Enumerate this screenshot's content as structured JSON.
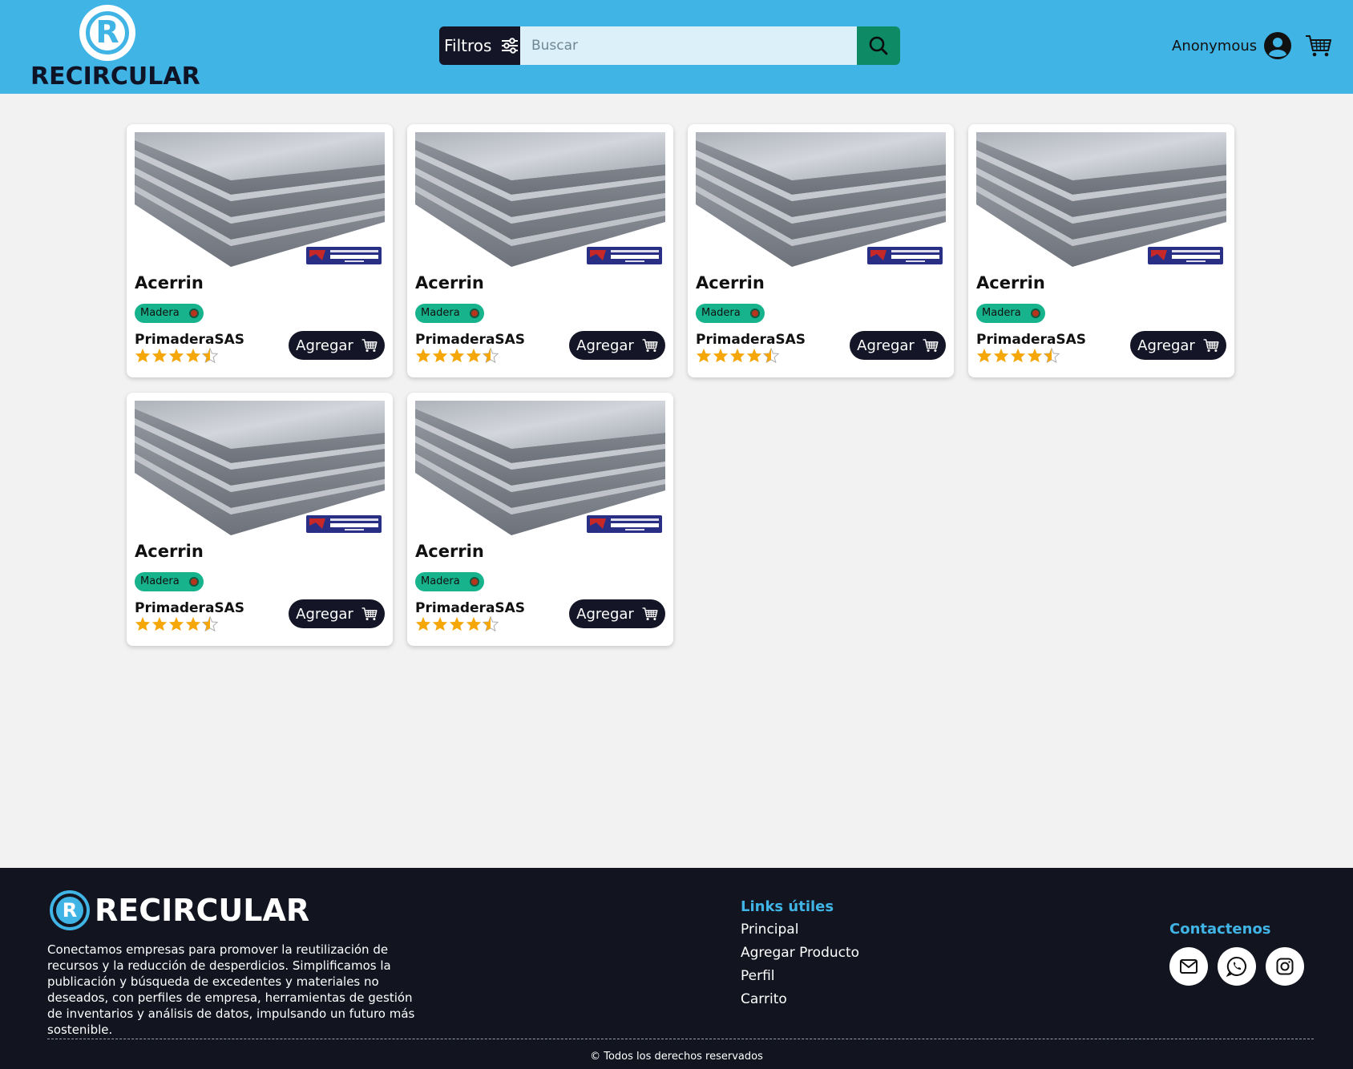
{
  "brand": {
    "name": "RECIRCULAR",
    "logo_letter": "R",
    "primary_color": "#41b4e6",
    "dark_color": "#141526",
    "accent_green": "#0e8a65"
  },
  "header": {
    "filters_label": "Filtros",
    "search_placeholder": "Buscar",
    "user_name": "Anonymous"
  },
  "products": [
    {
      "title": "Acerrin",
      "category": "Madera",
      "seller": "PrimaderaSAS",
      "rating": 4.5,
      "add_label": "Agregar"
    },
    {
      "title": "Acerrin",
      "category": "Madera",
      "seller": "PrimaderaSAS",
      "rating": 4.5,
      "add_label": "Agregar"
    },
    {
      "title": "Acerrin",
      "category": "Madera",
      "seller": "PrimaderaSAS",
      "rating": 4.5,
      "add_label": "Agregar"
    },
    {
      "title": "Acerrin",
      "category": "Madera",
      "seller": "PrimaderaSAS",
      "rating": 4.5,
      "add_label": "Agregar"
    },
    {
      "title": "Acerrin",
      "category": "Madera",
      "seller": "PrimaderaSAS",
      "rating": 4.5,
      "add_label": "Agregar"
    },
    {
      "title": "Acerrin",
      "category": "Madera",
      "seller": "PrimaderaSAS",
      "rating": 4.5,
      "add_label": "Agregar"
    }
  ],
  "footer": {
    "description": "Conectamos empresas para promover la reutilización de recursos y la reducción de desperdicios. Simplificamos la publicación y búsqueda de excedentes y materiales no deseados, con perfiles de empresa, herramientas de gestión de inventarios y análisis de datos, impulsando un futuro más sostenible.",
    "links_title": "Links útiles",
    "links": [
      "Principal",
      "Agregar Producto",
      "Perfil",
      "Carrito"
    ],
    "contact_title": "Contactenos",
    "contact_icons": [
      "mail-icon",
      "whatsapp-icon",
      "instagram-icon"
    ],
    "copyright": "© Todos los derechos reservados"
  }
}
